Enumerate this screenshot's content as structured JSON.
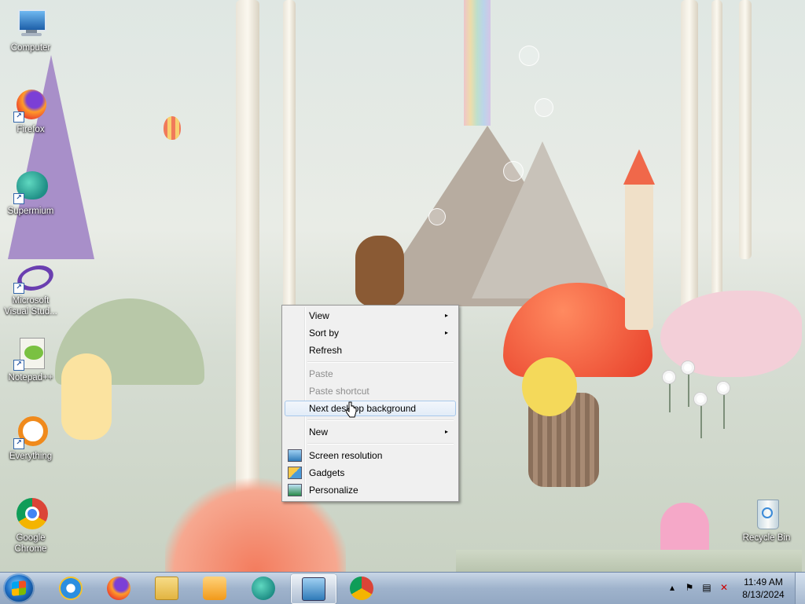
{
  "desktop_icons": [
    {
      "label": "Computer",
      "icon": "computer-icon"
    },
    {
      "label": "Firefox",
      "icon": "firefox-icon"
    },
    {
      "label": "Supermium",
      "icon": "supermium-icon"
    },
    {
      "label": "Microsoft Visual Stud...",
      "icon": "visual-studio-icon"
    },
    {
      "label": "Notepad++",
      "icon": "notepad-plus-plus-icon"
    },
    {
      "label": "Everything",
      "icon": "everything-search-icon"
    },
    {
      "label": "Google Chrome",
      "icon": "chrome-icon"
    },
    {
      "label": "Recycle Bin",
      "icon": "recycle-bin-icon"
    }
  ],
  "context_menu": {
    "items": [
      {
        "label": "View",
        "has_submenu": true,
        "enabled": true
      },
      {
        "label": "Sort by",
        "has_submenu": true,
        "enabled": true
      },
      {
        "label": "Refresh",
        "has_submenu": false,
        "enabled": true
      },
      {
        "label": "Paste",
        "has_submenu": false,
        "enabled": false
      },
      {
        "label": "Paste shortcut",
        "has_submenu": false,
        "enabled": false
      },
      {
        "label": "Next desktop background",
        "has_submenu": false,
        "enabled": true,
        "highlighted": true
      },
      {
        "label": "New",
        "has_submenu": true,
        "enabled": true
      },
      {
        "label": "Screen resolution",
        "has_submenu": false,
        "enabled": true,
        "icon": "screen-resolution-icon"
      },
      {
        "label": "Gadgets",
        "has_submenu": false,
        "enabled": true,
        "icon": "gadgets-icon"
      },
      {
        "label": "Personalize",
        "has_submenu": false,
        "enabled": true,
        "icon": "personalize-icon"
      }
    ],
    "submenu_arrow": "▸"
  },
  "taskbar": {
    "start_icon": "windows-start-icon",
    "pinned": [
      {
        "icon": "internet-explorer-icon"
      },
      {
        "icon": "firefox-icon"
      },
      {
        "icon": "file-explorer-icon"
      },
      {
        "icon": "media-player-icon"
      },
      {
        "icon": "supermium-icon"
      },
      {
        "icon": "control-panel-icon",
        "active": true
      },
      {
        "icon": "chrome-icon"
      }
    ],
    "tray_icons": [
      "show-hidden-icons-icon",
      "action-center-flag-icon",
      "network-icon",
      "volume-muted-icon"
    ],
    "clock": {
      "time": "11:49 AM",
      "date": "8/13/2024"
    }
  },
  "colors": {
    "taskbar_top": "#c8d6e6",
    "menu_bg": "#f0f0f0",
    "menu_highlight_border": "#a8c8ea",
    "disabled_text": "#8d8d8d"
  }
}
